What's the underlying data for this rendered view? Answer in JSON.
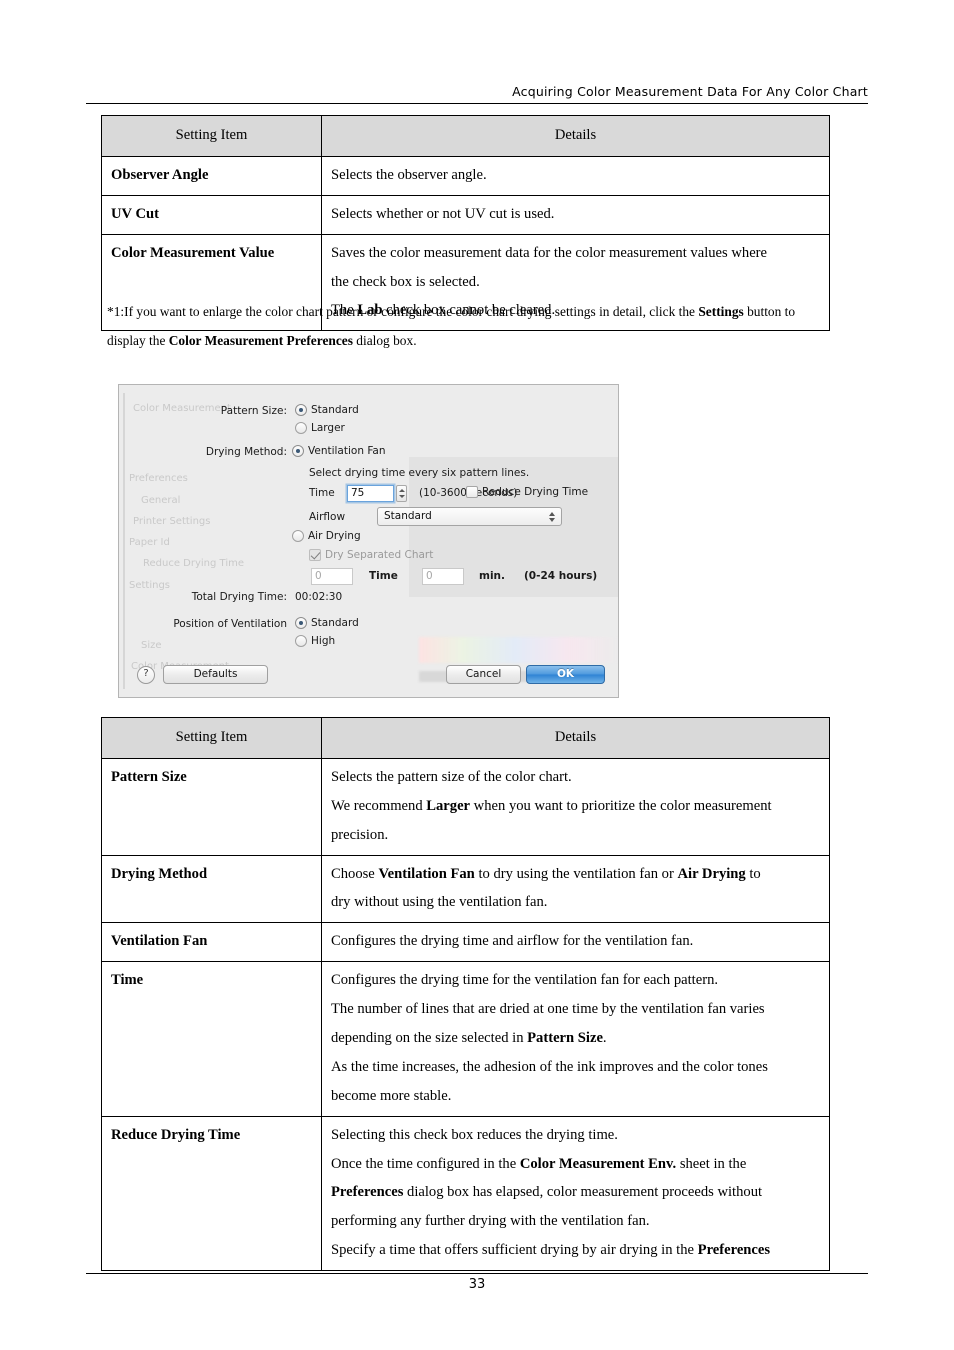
{
  "header": {
    "title": "Acquiring Color Measurement Data For Any Color Chart"
  },
  "footer": {
    "page_number": "33"
  },
  "table_one": {
    "columns": [
      "Setting Item",
      "Details"
    ],
    "rows": [
      {
        "item": "Observer Angle",
        "details": [
          "Selects the observer angle."
        ]
      },
      {
        "item": "UV Cut",
        "details": [
          "Selects whether or not UV cut is used."
        ]
      },
      {
        "item": "Color Measurement Value",
        "details": [
          "Saves the color measurement data for the color measurement values where",
          "the check box is selected.",
          "The Lab check box cannot be cleared."
        ]
      }
    ]
  },
  "footnote": {
    "line_1": "*1:If you want to enlarge the color chart pattern or configure the color chart drying settings in detail, click the Settings button to",
    "line_2": "display the Color Measurement Preferences dialog box.",
    "bold_terms": [
      "Settings",
      "Color Measurement Preferences"
    ]
  },
  "dialog": {
    "name": "Color Measurement Preferences",
    "pattern_size": {
      "label": "Pattern Size:",
      "options": [
        "Standard",
        "Larger"
      ],
      "selected": "Standard"
    },
    "drying_method": {
      "label": "Drying Method:",
      "options": [
        "Ventilation Fan",
        "Air Drying"
      ],
      "selected": "Ventilation Fan"
    },
    "ventilation_fan": {
      "hint": "Select drying time every six pattern lines.",
      "time_label": "Time",
      "time_value": "75",
      "time_range": "(10-3600 seconds)",
      "reduce_drying_time_label": "Reduce Drying Time",
      "reduce_drying_time_checked": false,
      "airflow_label": "Airflow",
      "airflow_value": "Standard"
    },
    "air_drying": {
      "dry_separated_chart_label": "Dry Separated Chart",
      "dry_separated_chart_checked": true,
      "dry_separated_chart_enabled": false,
      "hours_value": "0",
      "time_label": "Time",
      "minutes_value": "0",
      "minutes_unit": "min.",
      "range": "(0-24 hours)"
    },
    "total_drying_time": {
      "label": "Total Drying Time:",
      "value": "00:02:30"
    },
    "position_of_ventilation": {
      "label": "Position of Ventilation",
      "options": [
        "Standard",
        "High"
      ],
      "selected": "Standard"
    },
    "buttons": {
      "help": "?",
      "defaults": "Defaults",
      "cancel": "Cancel",
      "ok": "OK"
    },
    "accent_color": "#2f83d4"
  },
  "table_two": {
    "columns": [
      "Setting Item",
      "Details"
    ],
    "rows": [
      {
        "item": "Pattern Size",
        "details": [
          "Selects the pattern size of the color chart.",
          "We recommend Larger when you want to prioritize the color measurement",
          "precision."
        ]
      },
      {
        "item": "Drying Method",
        "details": [
          "Choose Ventilation Fan to dry using the ventilation fan or Air Drying to",
          "dry without using the ventilation fan."
        ]
      },
      {
        "item": "Ventilation Fan",
        "details": [
          "Configures the drying time and airflow for the ventilation fan."
        ]
      },
      {
        "item": "Time",
        "details": [
          "Configures the drying time for the ventilation fan for each pattern.",
          "The number of lines that are dried at one time by the ventilation fan varies",
          "depending on the size selected in Pattern Size.",
          "As the time increases, the adhesion of the ink improves and the color tones",
          "become more stable."
        ]
      },
      {
        "item": "Reduce Drying Time",
        "details": [
          "Selecting this check box reduces the drying time.",
          "Once the time configured in the Color Measurement Env. sheet in the",
          "Preferences dialog box has elapsed, color measurement proceeds without",
          "performing any further drying with the ventilation fan.",
          "Specify a time that offers sufficient drying by air drying in the Preferences"
        ]
      }
    ]
  },
  "ghost_text": {
    "lines": [
      "Preferences",
      "General",
      "Printer Settings",
      "Paper Id",
      "Reduce Drying Time",
      "Settings",
      "Size",
      "Color Measurement"
    ]
  }
}
